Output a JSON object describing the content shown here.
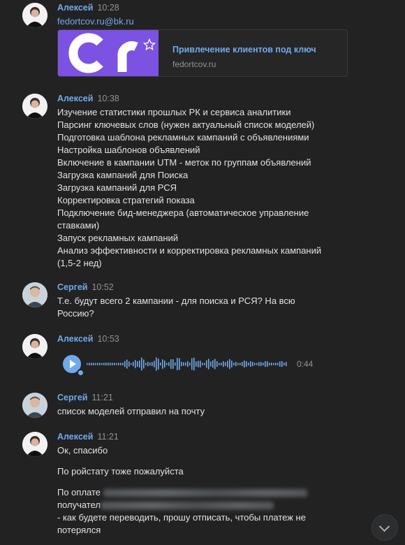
{
  "messages": [
    {
      "author": "Алексей",
      "time": "10:28",
      "link_text": "fedortcov.ru@bk.ru",
      "card": {
        "title": "Привлечение клиентов под ключ",
        "domain": "fedortcov.ru",
        "star_icon": "star-icon"
      }
    },
    {
      "author": "Алексей",
      "time": "10:38",
      "lines": [
        "Изучение статистики прошлых РК и сервиса аналитики",
        "Парсинг ключевых слов (нужен актуальный список моделей)",
        "Подготовка шаблона рекламных кампаний с объявлениями",
        "Настройка шаблонов объявлений",
        "Включение в кампании UTM - меток по группам объявлений",
        "Загрузка кампаний для Поиска",
        "Загрузка кампаний для РСЯ",
        "Корректировка стратегий показа",
        "Подключение бид-менеджера (автоматическое управление",
        "ставками)",
        "Запуск рекламных кампаний",
        "Анализ эффективности и корректировка рекламных кампаний",
        "(1,5-2 нед)"
      ]
    },
    {
      "author": "Сергей",
      "time": "10:52",
      "lines": [
        "Т.е. будут всего 2 кампании - для поиска и РСЯ? На всю",
        "Россию?"
      ]
    },
    {
      "author": "Алексей",
      "time": "10:53",
      "voice": {
        "duration": "0:44",
        "accent": "#71aaeb"
      }
    },
    {
      "author": "Сергей",
      "time": "11:21",
      "lines": [
        "список моделей отправил на почту"
      ]
    },
    {
      "author": "Алексей",
      "time": "11:21",
      "lines": [
        "Ок, спасибо",
        "По ройстату тоже пожалуйста",
        "По оплате",
        "получател",
        "- как будете переводить, прошу отписать, чтобы платеж не",
        "потерялся"
      ]
    }
  ],
  "colors": {
    "name": "#71aaeb",
    "background": "#222222",
    "text": "#e1e3e6",
    "muted": "#8f9399"
  },
  "scroll_button_icon": "chevron-down-icon"
}
